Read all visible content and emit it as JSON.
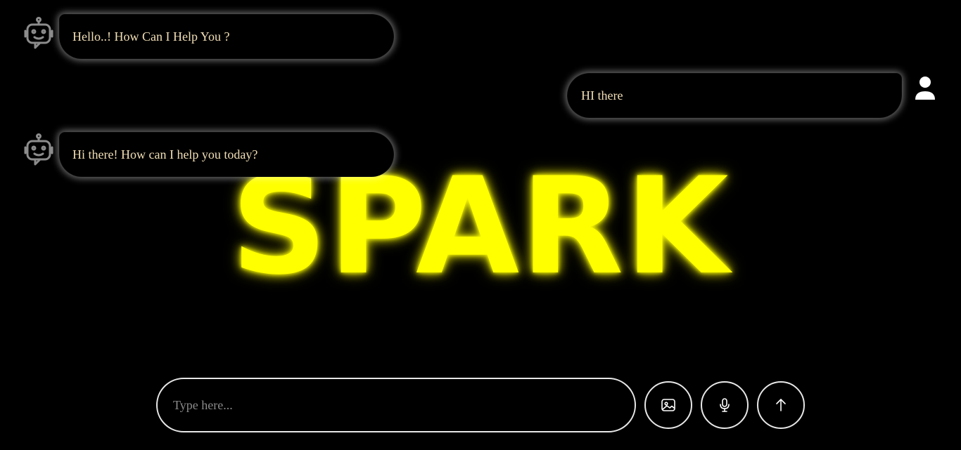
{
  "brand": {
    "title": "SPARK",
    "color": "#ffff00"
  },
  "messages": [
    {
      "role": "bot",
      "text": "Hello..! How Can I Help You ?",
      "icon": "robot-icon"
    },
    {
      "role": "user",
      "text": "HI there",
      "icon": "user-icon"
    },
    {
      "role": "bot",
      "text": "Hi there! How can I help you today?",
      "icon": "robot-icon"
    }
  ],
  "composer": {
    "placeholder": "Type here...",
    "value": "",
    "buttons": [
      {
        "name": "image-upload",
        "icon": "image-icon"
      },
      {
        "name": "voice-input",
        "icon": "microphone-icon"
      },
      {
        "name": "send",
        "icon": "arrow-up-icon"
      }
    ]
  },
  "colors": {
    "background": "#000000",
    "bubble_text": "#f2dfb6",
    "border": "#e7e7e7"
  }
}
